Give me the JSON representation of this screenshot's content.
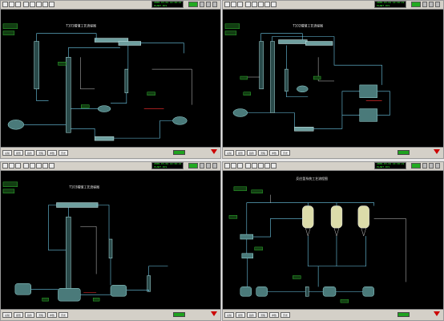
{
  "panels": [
    {
      "title": "T101精馏工艺流程图",
      "clock_lines": [
        "2009-03-04 10:30:21",
        "PLANT DCS"
      ],
      "tabs": [
        "总貌",
        "报警",
        "趋势",
        "流程",
        "参数",
        "历史"
      ]
    },
    {
      "title": "T102精馏工艺流程图",
      "clock_lines": [
        "2009-03-04 10:30:21",
        "PLANT DCS"
      ],
      "tabs": [
        "总貌",
        "报警",
        "趋势",
        "流程",
        "参数",
        "历史"
      ]
    },
    {
      "title": "T103精馏工艺流程图",
      "clock_lines": [
        "2009-03-04 10:30:21",
        "PLANT DCS"
      ],
      "tabs": [
        "总貌",
        "报警",
        "趋势",
        "流程",
        "参数",
        "历史"
      ]
    },
    {
      "title": "反应釜系统工艺流程图",
      "clock_lines": [
        "2009-03-04 10:30:21",
        "PLANT DCS"
      ],
      "tabs": [
        "总貌",
        "报警",
        "趋势",
        "流程",
        "参数",
        "历史"
      ]
    }
  ],
  "colors": {
    "background": "#000000",
    "pipe": "#6ec8e6",
    "alarm": "#ff3030",
    "ok": "#1fa21f",
    "toolbar": "#d4d0c8"
  }
}
